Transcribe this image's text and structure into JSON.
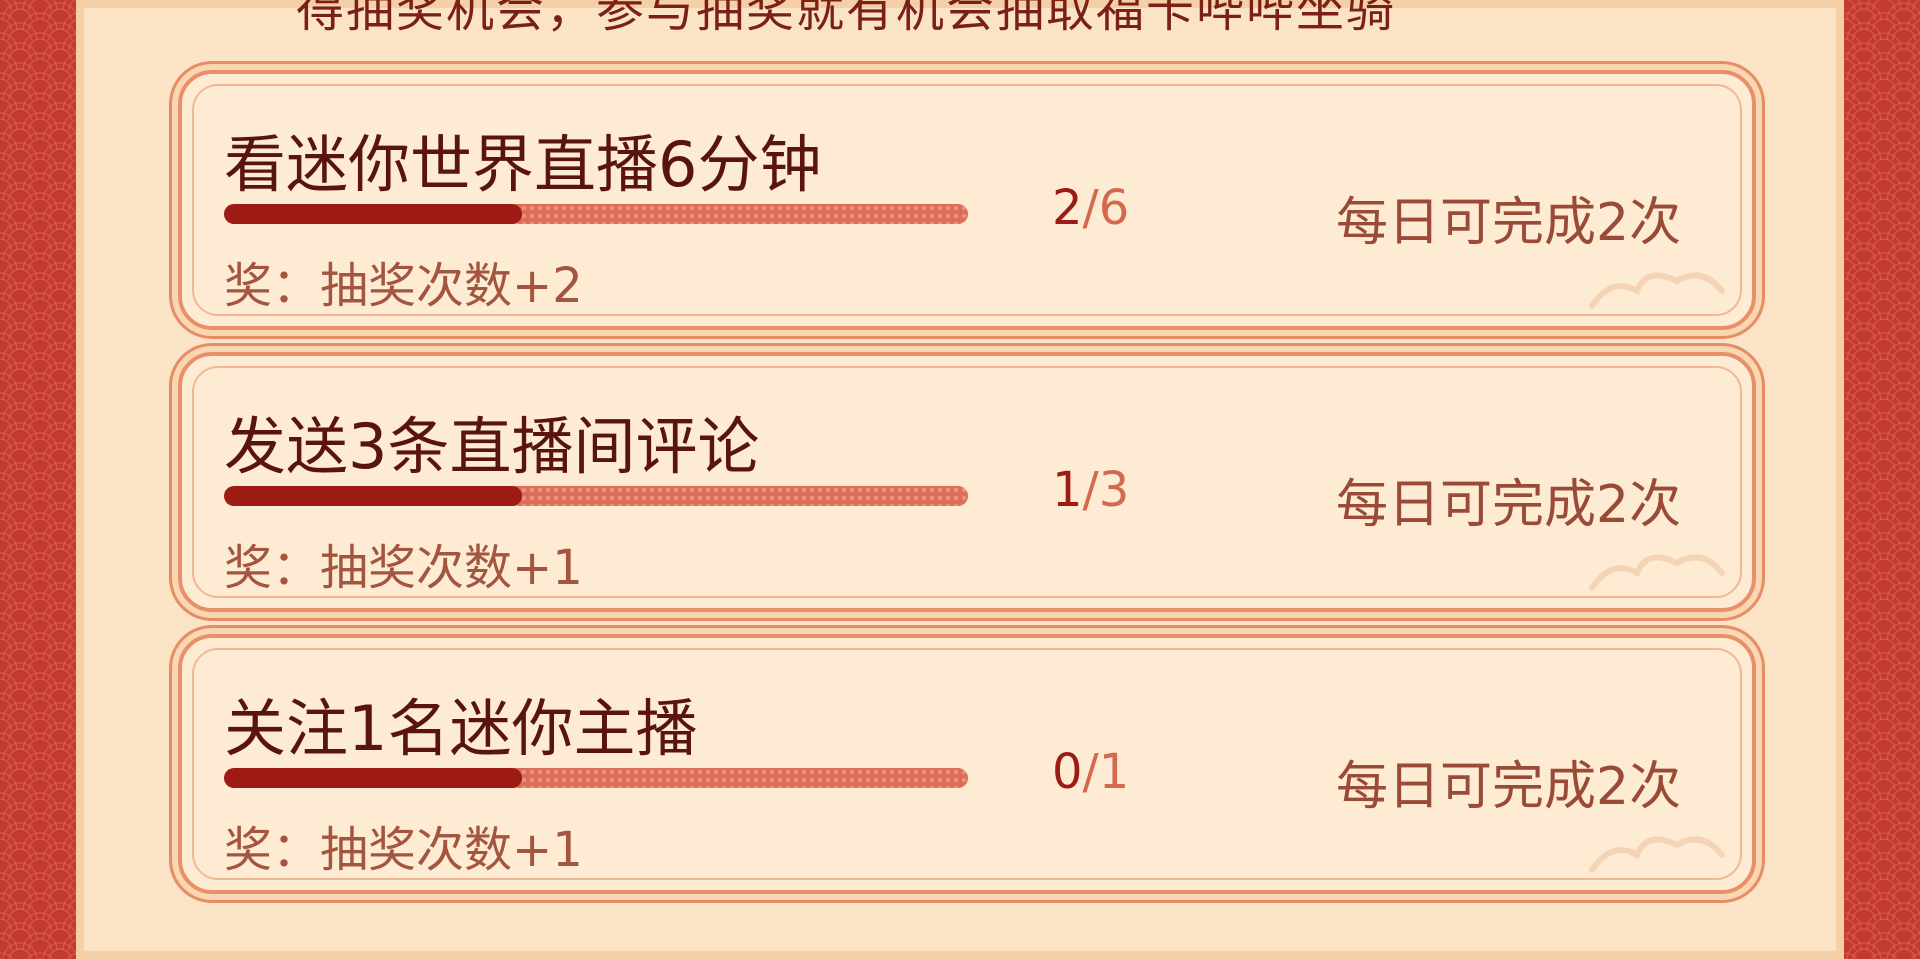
{
  "header": {
    "intro_text": "得抽奖机会，参与抽奖就有机会抽取福卡哔哔坐骑"
  },
  "tasks": [
    {
      "title": "看迷你世界直播6分钟",
      "done": "2",
      "sep": "/",
      "total": "6",
      "progress": 0.4,
      "reward": "奖：抽奖次数+2",
      "limit": "每日可完成2次"
    },
    {
      "title": "发送3条直播间评论",
      "done": "1",
      "sep": "/",
      "total": "3",
      "progress": 0.4,
      "reward": "奖：抽奖次数+1",
      "limit": "每日可完成2次"
    },
    {
      "title": "关注1名迷你主播",
      "done": "0",
      "sep": "/",
      "total": "1",
      "progress": 0.4,
      "reward": "奖：抽奖次数+1",
      "limit": "每日可完成2次"
    }
  ],
  "colors": {
    "accent": "#9e1a14",
    "panel": "#fbe3c6",
    "border": "#e9906a",
    "side": "#c33b2f"
  }
}
